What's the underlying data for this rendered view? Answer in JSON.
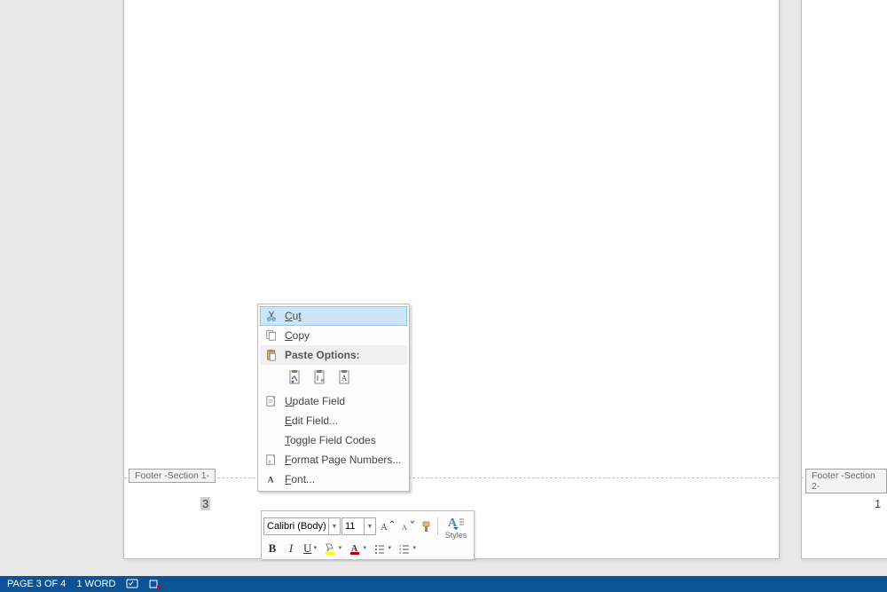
{
  "footer": {
    "section_label_1": "Footer -Section 1-",
    "section_label_2": "Footer -Section 2-",
    "page_number_left": "3",
    "page_number_right": "1"
  },
  "context_menu": {
    "cut": "Cut",
    "copy": "Copy",
    "paste_options": "Paste Options:",
    "update_field": "Update Field",
    "edit_field": "Edit Field...",
    "toggle_field_codes": "Toggle Field Codes",
    "format_page_numbers": "Format Page Numbers...",
    "font": "Font..."
  },
  "mini_toolbar": {
    "font_name": "Calibri (Body)",
    "font_size": "11",
    "bold": "B",
    "italic": "I",
    "underline": "U",
    "styles_label": "Styles"
  },
  "status_bar": {
    "page": "PAGE 3 OF 4",
    "words": "1 WORD"
  }
}
